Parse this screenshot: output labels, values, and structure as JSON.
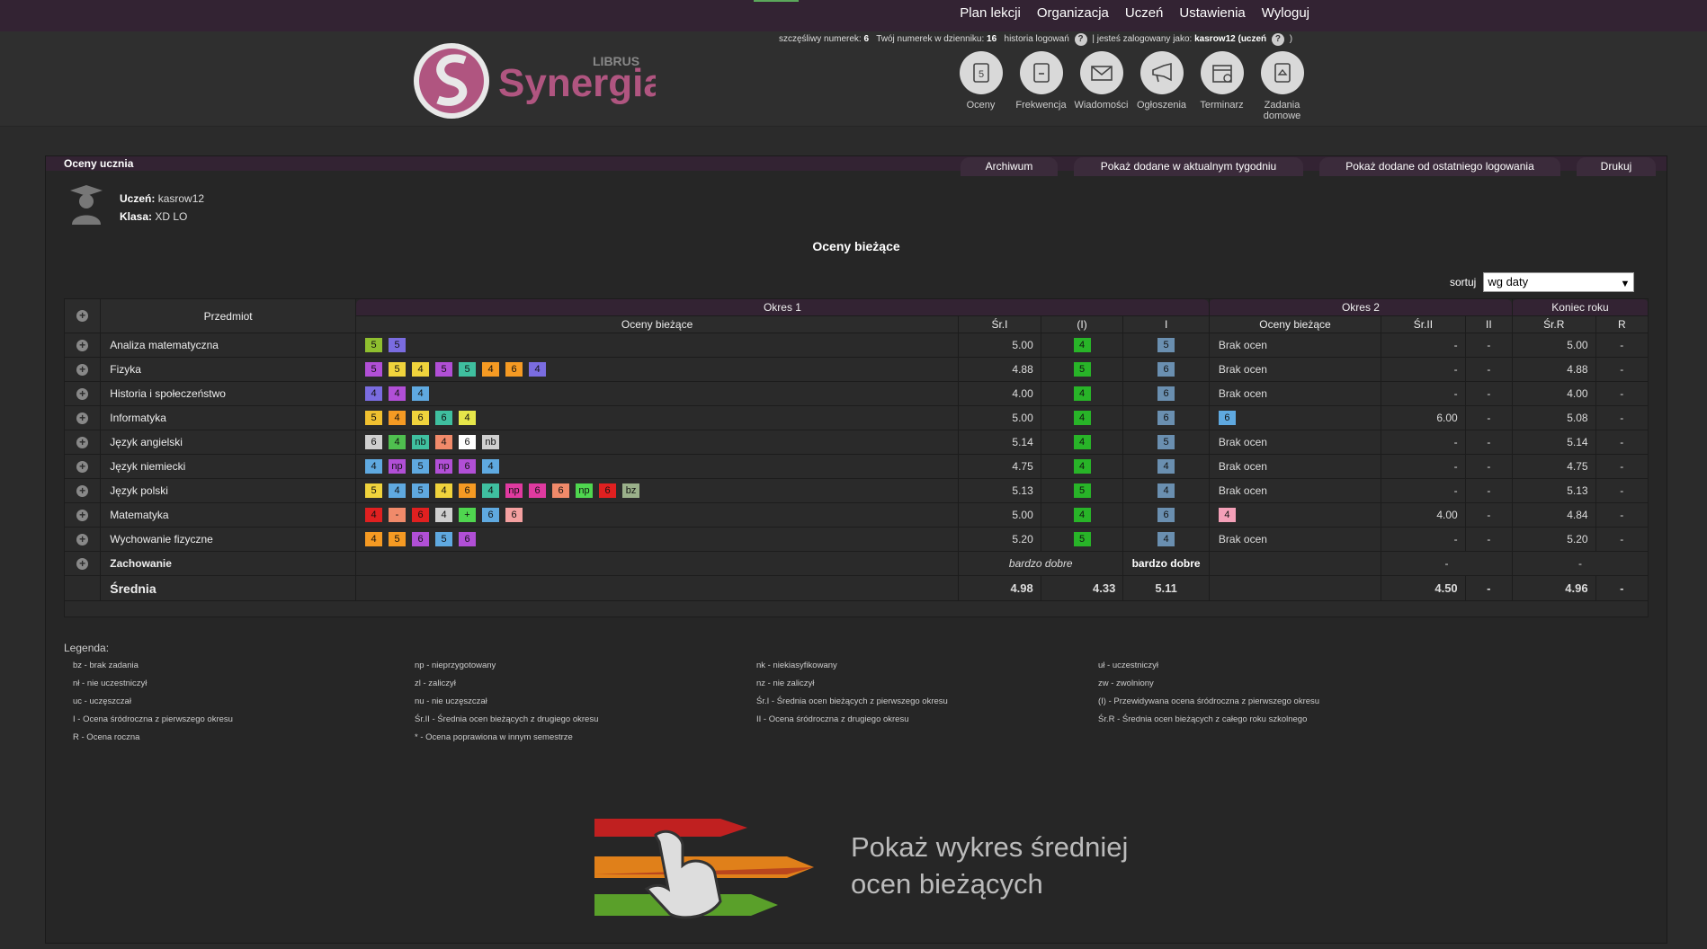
{
  "topmenu": [
    "Plan lekcji",
    "Organizacja",
    "Uczeń",
    "Ustawienia",
    "Wyloguj"
  ],
  "info": {
    "lucky_label": "szczęśliwy numerek:",
    "lucky": "6",
    "diary_label": "Twój numerek w dzienniku:",
    "diary": "16",
    "history": "historia logowań",
    "logged_label": "| jesteś zalogowany jako:",
    "logged": "kasrow12 (uczeń",
    "close": ")"
  },
  "logo": {
    "brand": "Synergia",
    "sub": "LIBRUS"
  },
  "icons": [
    {
      "name": "Oceny",
      "icon": "grades-icon"
    },
    {
      "name": "Frekwencja",
      "icon": "attendance-icon"
    },
    {
      "name": "Wiadomości",
      "icon": "envelope-icon"
    },
    {
      "name": "Ogłoszenia",
      "icon": "megaphone-icon"
    },
    {
      "name": "Terminarz",
      "icon": "calendar-icon"
    },
    {
      "name": "Zadania domowe",
      "icon": "homework-icon"
    }
  ],
  "panel": {
    "title": "Oceny ucznia",
    "tabs": [
      "Archiwum",
      "Pokaż dodane w aktualnym tygodniu",
      "Pokaż dodane od ostatniego logowania",
      "Drukuj"
    ]
  },
  "student": {
    "name_label": "Uczeń:",
    "name": "kasrow12",
    "class_label": "Klasa:",
    "class": "XD LO"
  },
  "section_title": "Oceny bieżące",
  "sort": {
    "label": "sortuj",
    "value": "wg daty"
  },
  "table": {
    "subject_header": "Przedmiot",
    "period1": "Okres 1",
    "period2": "Okres 2",
    "year_end": "Koniec roku",
    "sub1": [
      "Oceny bieżące",
      "Śr.I",
      "(I)",
      "I"
    ],
    "sub2": [
      "Oceny bieżące",
      "Śr.II",
      "II"
    ],
    "sub3": [
      "Śr.R",
      "R"
    ],
    "rows": [
      {
        "subject": "Analiza matematyczna",
        "g1": [
          [
            "5",
            "#8fbf2f"
          ],
          [
            "5",
            "#7a6ce0"
          ]
        ],
        "sr1": "5.00",
        "pred": "4",
        "i": "5",
        "g2": "Brak ocen",
        "g2grades": [],
        "sr2": "-",
        "ii": "-",
        "srr": "5.00",
        "r": "-"
      },
      {
        "subject": "Fizyka",
        "g1": [
          [
            "5",
            "#b14fd6"
          ],
          [
            "5",
            "#f0d33c"
          ],
          [
            "4",
            "#f0d33c"
          ],
          [
            "5",
            "#b14fd6"
          ],
          [
            "5",
            "#3fbf9f"
          ],
          [
            "4",
            "#f59a23"
          ],
          [
            "6",
            "#f59a23"
          ],
          [
            "4",
            "#7a6ce0"
          ]
        ],
        "sr1": "4.88",
        "pred": "5",
        "i": "6",
        "g2": "Brak ocen",
        "g2grades": [],
        "sr2": "-",
        "ii": "-",
        "srr": "4.88",
        "r": "-"
      },
      {
        "subject": "Historia i społeczeństwo",
        "g1": [
          [
            "4",
            "#7a6ce0"
          ],
          [
            "4",
            "#b14fd6"
          ],
          [
            "4",
            "#5fa9e0"
          ]
        ],
        "sr1": "4.00",
        "pred": "4",
        "i": "6",
        "g2": "Brak ocen",
        "g2grades": [],
        "sr2": "-",
        "ii": "-",
        "srr": "4.00",
        "r": "-"
      },
      {
        "subject": "Informatyka",
        "g1": [
          [
            "5",
            "#f0c030"
          ],
          [
            "4",
            "#f59a23"
          ],
          [
            "6",
            "#f0d33c"
          ],
          [
            "6",
            "#3fbf9f"
          ],
          [
            "4",
            "#e6e64a"
          ]
        ],
        "sr1": "5.00",
        "pred": "4",
        "i": "6",
        "g2": "",
        "g2grades": [
          [
            "6",
            "#5fa9e0"
          ]
        ],
        "sr2": "6.00",
        "ii": "-",
        "srr": "5.08",
        "r": "-"
      },
      {
        "subject": "Język angielski",
        "g1": [
          [
            "6",
            "#cfcfcf"
          ],
          [
            "4",
            "#4fbf4f"
          ],
          [
            "nb",
            "#3fbf9f"
          ],
          [
            "4",
            "#f08a6a"
          ],
          [
            "6",
            "#ffffff"
          ],
          [
            "nb",
            "#cfcfcf"
          ]
        ],
        "sr1": "5.14",
        "pred": "4",
        "i": "5",
        "g2": "Brak ocen",
        "g2grades": [],
        "sr2": "-",
        "ii": "-",
        "srr": "5.14",
        "r": "-"
      },
      {
        "subject": "Język niemiecki",
        "g1": [
          [
            "4",
            "#5fa9e0"
          ],
          [
            "np",
            "#b14fd6"
          ],
          [
            "5",
            "#5fa9e0"
          ],
          [
            "np",
            "#b14fd6"
          ],
          [
            "6",
            "#b14fd6"
          ],
          [
            "4",
            "#5fa9e0"
          ]
        ],
        "sr1": "4.75",
        "pred": "4",
        "i": "4",
        "g2": "Brak ocen",
        "g2grades": [],
        "sr2": "-",
        "ii": "-",
        "srr": "4.75",
        "r": "-"
      },
      {
        "subject": "Język polski",
        "g1": [
          [
            "5",
            "#f0d33c"
          ],
          [
            "4",
            "#5fa9e0"
          ],
          [
            "5",
            "#5fa9e0"
          ],
          [
            "4",
            "#f0d33c"
          ],
          [
            "6",
            "#f59a23"
          ],
          [
            "4",
            "#3fbf9f"
          ],
          [
            "np",
            "#e03aa0"
          ],
          [
            "6",
            "#e03aa0"
          ],
          [
            "6",
            "#f08a6a"
          ],
          [
            "np",
            "#4fd64f"
          ],
          [
            "6",
            "#e02020"
          ],
          [
            "bz",
            "#9ab08a"
          ]
        ],
        "sr1": "5.13",
        "pred": "5",
        "i": "4",
        "g2": "Brak ocen",
        "g2grades": [],
        "sr2": "-",
        "ii": "-",
        "srr": "5.13",
        "r": "-"
      },
      {
        "subject": "Matematyka",
        "g1": [
          [
            "4",
            "#e02020"
          ],
          [
            "-",
            "#f08a6a"
          ],
          [
            "6",
            "#e02020"
          ],
          [
            "4",
            "#cfcfcf"
          ],
          [
            "+",
            "#4fd64f"
          ],
          [
            "6",
            "#5fa9e0"
          ],
          [
            "6",
            "#f4a0a0"
          ]
        ],
        "sr1": "5.00",
        "pred": "4",
        "i": "6",
        "g2": "",
        "g2grades": [
          [
            "4",
            "#f4a0b8"
          ]
        ],
        "sr2": "4.00",
        "ii": "-",
        "srr": "4.84",
        "r": "-"
      },
      {
        "subject": "Wychowanie fizyczne",
        "g1": [
          [
            "4",
            "#f59a23"
          ],
          [
            "5",
            "#f59a23"
          ],
          [
            "6",
            "#b14fd6"
          ],
          [
            "5",
            "#5fa9e0"
          ],
          [
            "6",
            "#b14fd6"
          ]
        ],
        "sr1": "5.20",
        "pred": "5",
        "i": "4",
        "g2": "Brak ocen",
        "g2grades": [],
        "sr2": "-",
        "ii": "-",
        "srr": "5.20",
        "r": "-"
      }
    ],
    "behavior": {
      "subject": "Zachowanie",
      "pred": "bardzo dobre",
      "i": "bardzo dobre",
      "ii": "-",
      "r": "-"
    },
    "average": {
      "subject": "Średnia",
      "sr1": "4.98",
      "pred": "4.33",
      "i": "5.11",
      "sr2": "4.50",
      "ii": "-",
      "srr": "4.96",
      "r": "-"
    }
  },
  "legend": {
    "title": "Legenda:",
    "items": [
      "bz - brak zadania",
      "np - nieprzygotowany",
      "nk - niekiasyfikowany",
      "uł - uczestniczył",
      "nł - nie uczestniczył",
      "zl - zaliczył",
      "nz - nie zaliczył",
      "zw - zwolniony",
      "uc - uczęszczał",
      "nu - nie uczęszczał",
      "Śr.I - Średnia ocen bieżących z pierwszego okresu",
      "(I) - Przewidywana ocena śródroczna z pierwszego okresu",
      "I - Ocena śródroczna z pierwszego okresu",
      "Śr.II - Średnia ocen bieżących z drugiego okresu",
      "II - Ocena śródroczna z drugiego okresu",
      "Śr.R - Średnia ocen bieżących z całego roku szkolnego",
      "R - Ocena roczna",
      "* - Ocena poprawiona w innym semestrze"
    ]
  },
  "chart_button": {
    "line1": "Pokaż wykres średniej",
    "line2": "ocen bieżących"
  },
  "colors": {
    "predicted": "#28b428",
    "midterm": "#6a8fb0",
    "accent": "#b0557a"
  }
}
